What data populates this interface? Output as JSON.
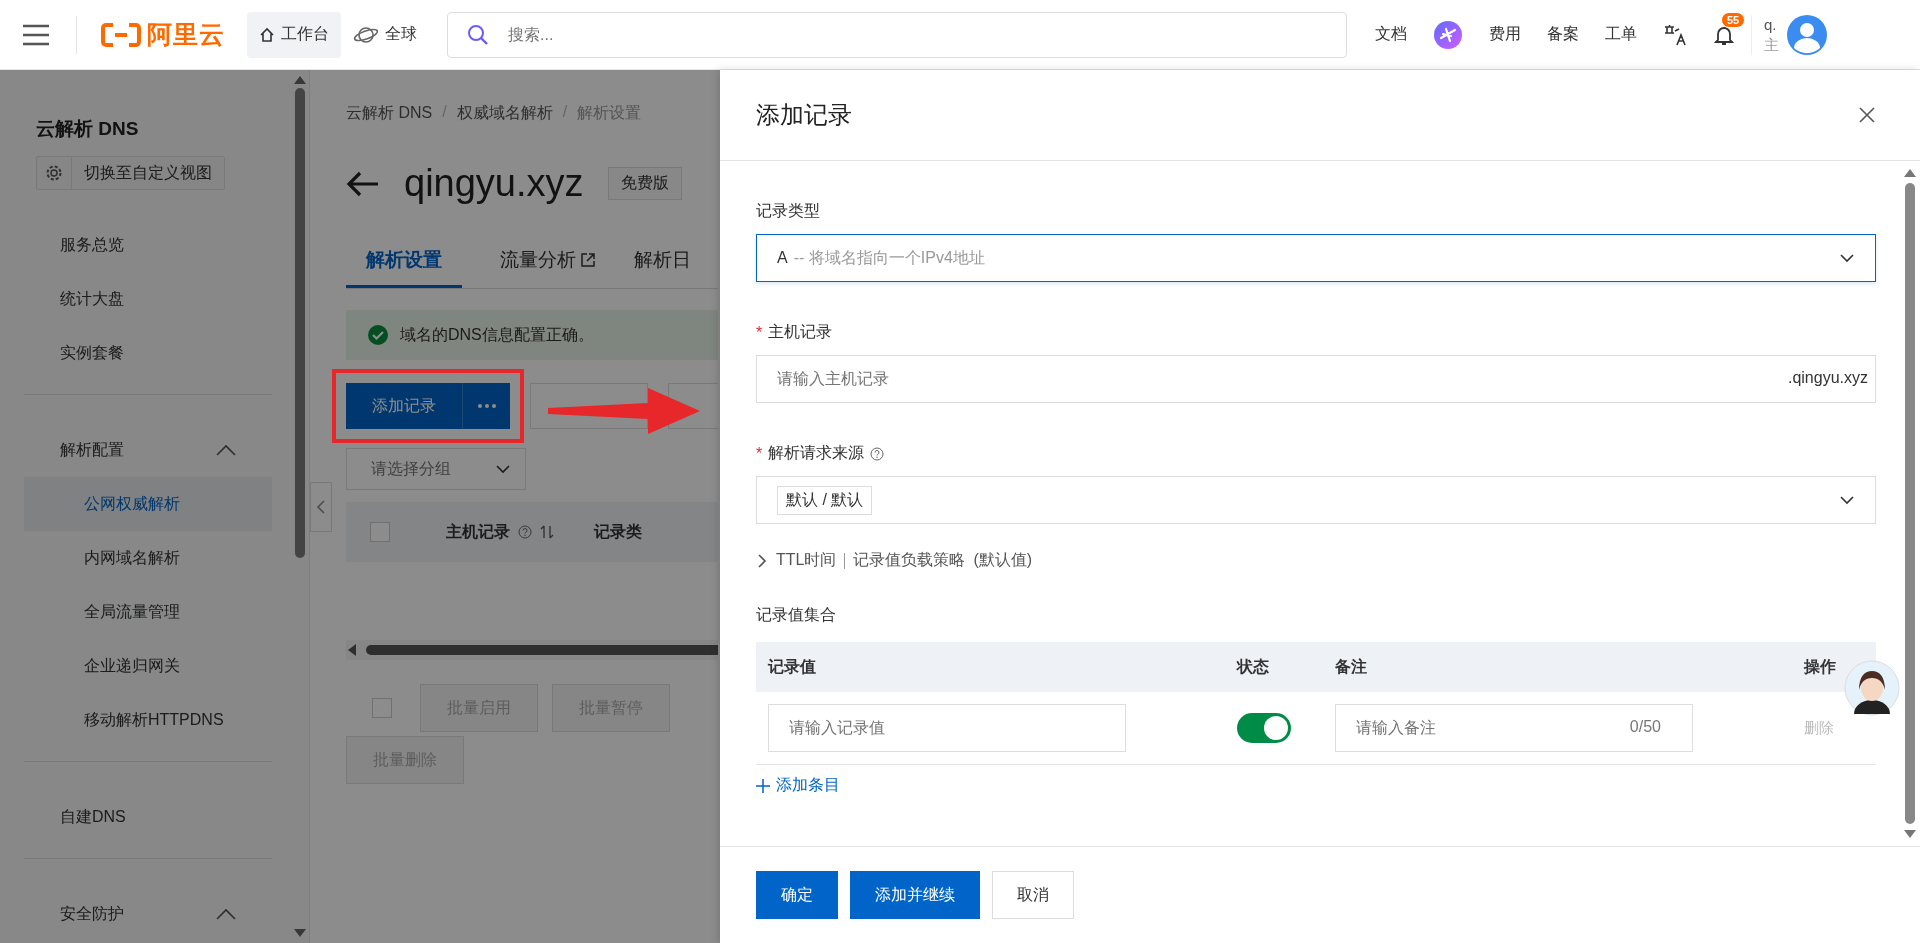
{
  "header": {
    "logo_text": "阿里云",
    "workbench": "工作台",
    "region": "全球",
    "search": {
      "placeholder": "搜索..."
    },
    "nav": [
      {
        "kind": "link",
        "label": "文档"
      },
      {
        "kind": "assistant"
      },
      {
        "kind": "link",
        "label": "费用"
      },
      {
        "kind": "link",
        "label": "备案"
      },
      {
        "kind": "link",
        "label": "工单"
      },
      {
        "kind": "translate"
      },
      {
        "kind": "bell",
        "badge": "55"
      }
    ],
    "user": {
      "name": "q.",
      "role": "主"
    }
  },
  "sidebar": {
    "title": "云解析 DNS",
    "view_button": "切换至自定义视图",
    "sections": [
      {
        "items": [
          {
            "label": "服务总览",
            "selected": false
          },
          {
            "label": "统计大盘",
            "selected": false
          },
          {
            "label": "实例套餐",
            "selected": false
          }
        ]
      },
      {
        "label": "解析配置",
        "expanded": true,
        "items": [
          {
            "label": "公网权威解析",
            "selected": true
          },
          {
            "label": "内网域名解析",
            "selected": false
          },
          {
            "label": "全局流量管理",
            "selected": false
          },
          {
            "label": "企业递归网关",
            "selected": false
          },
          {
            "label": "移动解析HTTPDNS",
            "selected": false
          }
        ]
      },
      {
        "items": [
          {
            "label": "自建DNS",
            "selected": false
          }
        ]
      },
      {
        "label": "安全防护",
        "expanded": true
      }
    ]
  },
  "main": {
    "breadcrumb": [
      "云解析 DNS",
      "权威域名解析",
      "解析设置"
    ],
    "breadcrumb_separator": "/",
    "domain": "qingyu.xyz",
    "edition": "免费版",
    "tabs": [
      {
        "label": "解析设置",
        "selected": true,
        "external": false
      },
      {
        "label": "流量分析",
        "selected": false,
        "external": true
      },
      {
        "label": "解析日",
        "selected": false,
        "external": false
      }
    ],
    "alert": "域名的DNS信息配置正确。",
    "add_button": "添加记录",
    "highlighted": true,
    "group_select": {
      "placeholder": "请选择分组"
    },
    "table": {
      "checked": false,
      "columns": [
        {
          "label": "主机记录",
          "help": true,
          "sortable": true
        },
        {
          "label": "记录类",
          "help": false,
          "sortable": false
        }
      ]
    },
    "batch": {
      "checked": false,
      "buttons": [
        {
          "label": "批量启用",
          "disabled": true
        },
        {
          "label": "批量暂停",
          "disabled": true
        },
        {
          "label": "批量删除",
          "disabled": true
        }
      ]
    }
  },
  "drawer": {
    "title": "添加记录",
    "record_type": {
      "label": "记录类型",
      "value": "A",
      "description": "-- 将域名指向一个IPv4地址"
    },
    "host": {
      "required_mark": "*",
      "label": "主机记录",
      "placeholder": "请输入主机记录",
      "suffix": ".qingyu.xyz"
    },
    "source": {
      "required_mark": "*",
      "label": "解析请求来源",
      "help": true,
      "tag": "默认 / 默认"
    },
    "advanced": {
      "expanded": false,
      "parts": [
        "TTL时间",
        "记录值负载策略",
        "(默认值)"
      ]
    },
    "values": {
      "title": "记录值集合",
      "columns": [
        "记录值",
        "状态",
        "备注",
        "操作"
      ],
      "rows": [
        {
          "value_placeholder": "请输入记录值",
          "on": true,
          "note_placeholder": "请输入备注",
          "count": "0/50",
          "action": "删除"
        }
      ],
      "add": "添加条目"
    },
    "buttons": [
      {
        "label": "确定",
        "kind": "primary"
      },
      {
        "label": "添加并继续",
        "kind": "primary"
      },
      {
        "label": "取消",
        "kind": "default"
      }
    ]
  }
}
